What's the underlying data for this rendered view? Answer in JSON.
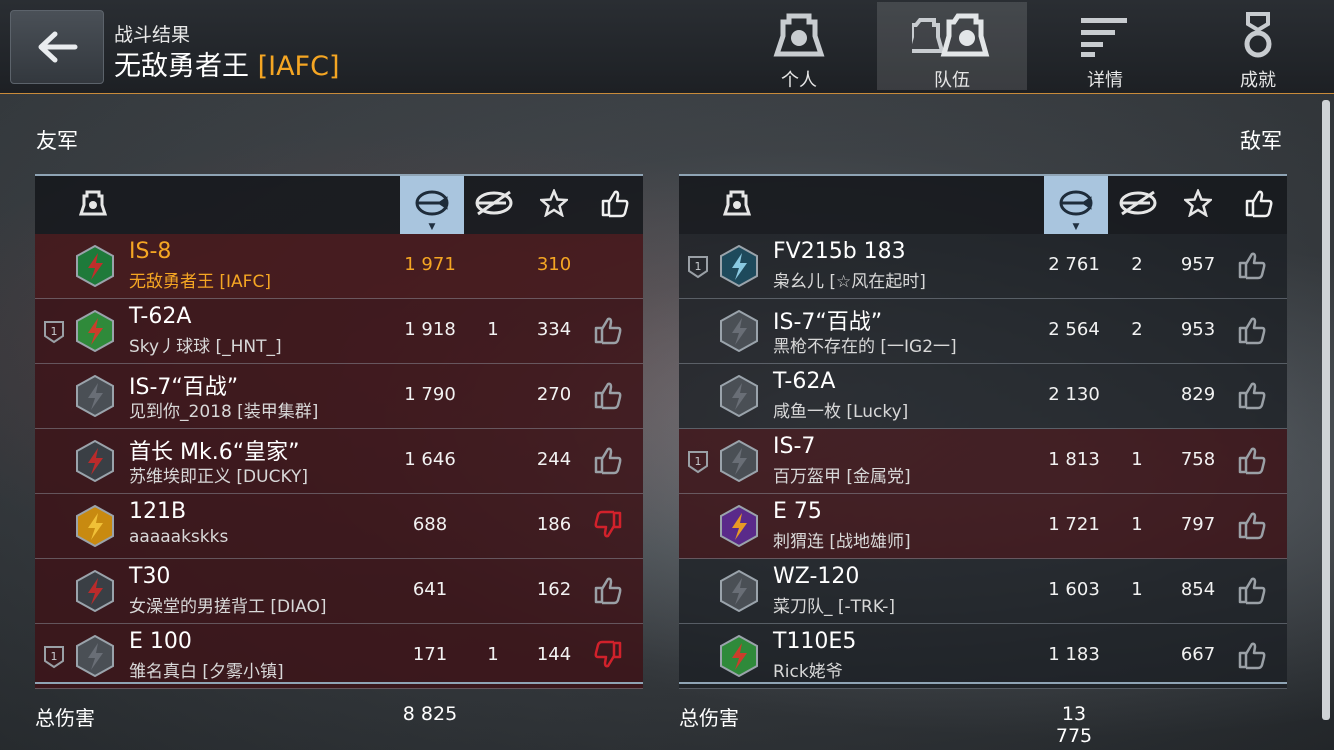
{
  "header": {
    "subtitle": "战斗结果",
    "player_name": "无敌勇者王",
    "player_clan": "[IAFC]",
    "tabs": [
      {
        "label": "个人",
        "icon": "single-tank-icon",
        "active": false
      },
      {
        "label": "队伍",
        "icon": "team-tanks-icon",
        "active": true
      },
      {
        "label": "详情",
        "icon": "details-lines-icon",
        "active": false
      },
      {
        "label": "成就",
        "icon": "medal-icon",
        "active": false
      }
    ]
  },
  "colors": {
    "accent": "#f5a623",
    "sorted_column": "#a9c5de",
    "dislike": "#d1212b",
    "row_red": "#3c1418"
  },
  "allies": {
    "label": "友军",
    "total_label": "总伤害",
    "total_damage": "8 825",
    "players": [
      {
        "tank": "IS-8",
        "player": "无敌勇者王 [IAFC]",
        "damage": "1 971",
        "kills": "",
        "xp": "310",
        "rank": false,
        "like": "none",
        "tank_icon": "christmas-badge-icon",
        "row": "first",
        "me": true
      },
      {
        "tank": "T-62A",
        "player": "Sky丿球球 [_HNT_]",
        "damage": "1 918",
        "kills": "1",
        "xp": "334",
        "rank": true,
        "like": "up",
        "tank_icon": "gift-box-badge-icon",
        "row": "red"
      },
      {
        "tank": "IS-7“百战”",
        "player": "见到你_2018 [装甲集群]",
        "damage": "1 790",
        "kills": "",
        "xp": "270",
        "rank": false,
        "like": "up",
        "tank_icon": "lightning-badge-icon",
        "row": "red"
      },
      {
        "tank": "首长 Mk.6“皇家”",
        "player": "苏维埃即正义 [DUCKY]",
        "damage": "1 646",
        "kills": "",
        "xp": "244",
        "rank": false,
        "like": "up",
        "tank_icon": "red-lightning-badge-icon",
        "row": "red"
      },
      {
        "tank": "121B",
        "player": "aaaaakskks",
        "damage": "688",
        "kills": "",
        "xp": "186",
        "rank": false,
        "like": "down",
        "tank_icon": "gold-gem-badge-icon",
        "row": "red"
      },
      {
        "tank": "T30",
        "player": "女澡堂的男搓背工 [DIAO]",
        "damage": "641",
        "kills": "",
        "xp": "162",
        "rank": false,
        "like": "up",
        "tank_icon": "red-lightning-badge-icon",
        "row": "red"
      },
      {
        "tank": "E 100",
        "player": "雏名真白 [夕雾小镇]",
        "damage": "171",
        "kills": "1",
        "xp": "144",
        "rank": true,
        "like": "down",
        "tank_icon": "lightning-badge-icon",
        "row": "red"
      }
    ]
  },
  "enemies": {
    "label": "敌军",
    "total_label": "总伤害",
    "total_damage": "13 775",
    "players": [
      {
        "tank": "FV215b 183",
        "player": "枭幺儿 [☆风在起时]",
        "damage": "2 761",
        "kills": "2",
        "xp": "957",
        "rank": true,
        "like": "up",
        "tank_icon": "champagne-badge-icon",
        "row": "dark"
      },
      {
        "tank": "IS-7“百战”",
        "player": "黑枪不存在的 [一IG2一]",
        "damage": "2 564",
        "kills": "2",
        "xp": "953",
        "rank": false,
        "like": "up",
        "tank_icon": "lightning-badge-icon",
        "row": "dark"
      },
      {
        "tank": "T-62A",
        "player": "咸鱼一枚 [Lucky]",
        "damage": "2 130",
        "kills": "",
        "xp": "829",
        "rank": false,
        "like": "up",
        "tank_icon": "lightning-badge-icon",
        "row": "dark"
      },
      {
        "tank": "IS-7",
        "player": "百万盔甲 [金属党]",
        "damage": "1 813",
        "kills": "1",
        "xp": "758",
        "rank": true,
        "like": "up",
        "tank_icon": "lightning-badge-icon",
        "row": "red"
      },
      {
        "tank": "E 75",
        "player": "刺猬连 [战地雄师]",
        "damage": "1 721",
        "kills": "1",
        "xp": "797",
        "rank": false,
        "like": "up",
        "tank_icon": "ornaments-badge-icon",
        "row": "red"
      },
      {
        "tank": "WZ-120",
        "player": "菜刀队_ [-TRK-]",
        "damage": "1 603",
        "kills": "1",
        "xp": "854",
        "rank": false,
        "like": "up",
        "tank_icon": "lightning-badge-icon",
        "row": "dark"
      },
      {
        "tank": "T110E5",
        "player": "Rick姥爷",
        "damage": "1 183",
        "kills": "",
        "xp": "667",
        "rank": false,
        "like": "up",
        "tank_icon": "gift-box-badge-icon",
        "row": "dark"
      }
    ]
  }
}
